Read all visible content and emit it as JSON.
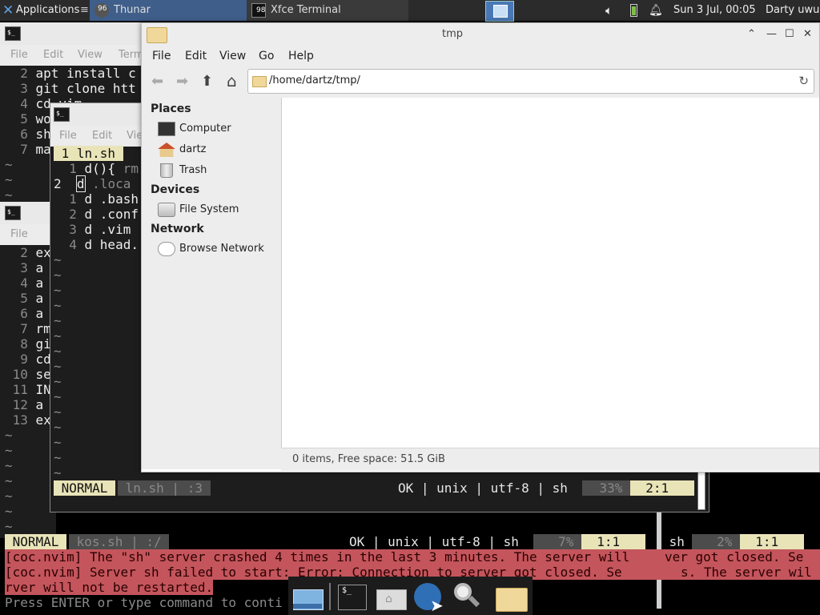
{
  "panel": {
    "apps_label": "Applications",
    "tasks": [
      {
        "label": "Thunar",
        "badge": "96"
      },
      {
        "label": "Xfce Terminal",
        "badge": "98"
      }
    ],
    "clock": "Sun  3 Jul, 00:05",
    "user": "Darty uwu"
  },
  "terminal_menu": [
    "File",
    "Edit",
    "View",
    "Terminal"
  ],
  "back_term": {
    "menu": [
      "File",
      "Edit",
      "View",
      "Term"
    ],
    "lines": [
      {
        "n": "2",
        "t": "apt install c"
      },
      {
        "n": "3",
        "t": "git clone htt"
      },
      {
        "n": "4",
        "t": "cd vim"
      },
      {
        "n": "5",
        "t": "wo"
      },
      {
        "n": "6",
        "t": "sh"
      },
      {
        "n": "7",
        "t": "ma"
      }
    ]
  },
  "mid_term": {
    "menu": [
      "File"
    ],
    "lines": [
      {
        "n": "2",
        "t": "ex"
      },
      {
        "n": "3",
        "t": "a"
      },
      {
        "n": "4",
        "t": "a"
      },
      {
        "n": "5",
        "t": "a"
      },
      {
        "n": "6",
        "t": "a"
      },
      {
        "n": "7",
        "t": "rm"
      },
      {
        "n": "8",
        "t": "gi"
      },
      {
        "n": "9",
        "t": "cd"
      },
      {
        "n": "10",
        "t": "se"
      },
      {
        "n": "11",
        "t": "IN"
      },
      {
        "n": "12",
        "t": "a"
      },
      {
        "n": "13",
        "t": "ex"
      }
    ]
  },
  "vim_win": {
    "menu": [
      "File",
      "Edit",
      "Vie"
    ],
    "tab": " 1 ln.sh ",
    "lines": [
      {
        "n": "1",
        "t": "d(){ rm"
      },
      {
        "n": "2",
        "t": "d .loca"
      },
      {
        "n": "1",
        "t": "d .bash"
      },
      {
        "n": "2",
        "t": "d .conf"
      },
      {
        "n": "3",
        "t": "d .vim"
      },
      {
        "n": "4",
        "t": "d head."
      }
    ],
    "status": {
      "mode": " NORMAL ",
      "file": " ln.sh | :3 ",
      "info": "OK | unix | utf-8 | sh ",
      "pct": " 33% ",
      "pos": "  2:1  "
    }
  },
  "bottom_status": {
    "mode": " NORMAL ",
    "file": " kos.sh | :/ ",
    "info": "OK | unix | utf-8 | sh ",
    "pct": " 7% ",
    "pos": "  1:1  ",
    "ft2": " sh ",
    "pct2": " 2% ",
    "pos2": "  1:1  "
  },
  "messages": [
    "[coc.nvim] The \"sh\" server crashed 4 times in the last 3 minutes. The server will",
    "[coc.nvim] Server sh failed to start: Error: Connection to server got closed. Se",
    "rver will not be restarted."
  ],
  "msg_right": [
    "ver got closed. Se",
    "s. The server wil"
  ],
  "prompt": "Press ENTER or type command to conti",
  "thunar": {
    "title": "tmp",
    "menu": [
      "File",
      "Edit",
      "View",
      "Go",
      "Help"
    ],
    "path": "/home/dartz/tmp/",
    "sections": [
      {
        "header": "Places",
        "items": [
          {
            "name": "computer",
            "label": "Computer"
          },
          {
            "name": "home",
            "label": "dartz"
          },
          {
            "name": "trash",
            "label": "Trash"
          }
        ]
      },
      {
        "header": "Devices",
        "items": [
          {
            "name": "filesystem",
            "label": "File System"
          }
        ]
      },
      {
        "header": "Network",
        "items": [
          {
            "name": "network",
            "label": "Browse Network"
          }
        ]
      }
    ],
    "status": "0 items, Free space: 51.5 GiB"
  }
}
